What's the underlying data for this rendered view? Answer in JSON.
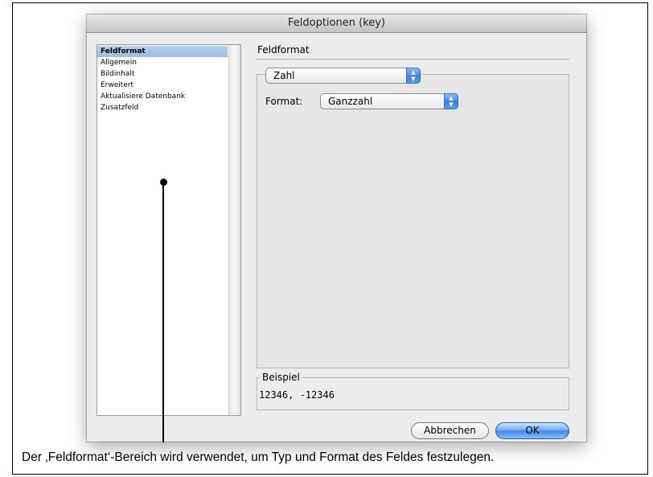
{
  "window": {
    "title": "Feldoptionen (key)"
  },
  "sidebar": {
    "items": [
      {
        "label": "Feldformat",
        "selected": true
      },
      {
        "label": "Allgemein",
        "selected": false
      },
      {
        "label": "Bildinhalt",
        "selected": false
      },
      {
        "label": "Erweitert",
        "selected": false
      },
      {
        "label": "Aktualisiere Datenbank",
        "selected": false
      },
      {
        "label": "Zusatzfeld",
        "selected": false
      }
    ]
  },
  "main": {
    "section_title": "Feldformat",
    "type_popup": {
      "value": "Zahl"
    },
    "format_label": "Format:",
    "format_popup": {
      "value": "Ganzzahl"
    },
    "example": {
      "legend": "Beispiel",
      "value": "12346, -12346"
    }
  },
  "buttons": {
    "cancel_label": "Abbrechen",
    "ok_label": "OK"
  },
  "caption": "Der ‚Feldformat‘-Bereich wird verwendet, um Typ und Format des Feldes festzulegen.",
  "colors": {
    "selection": "#b8d0ec",
    "accent": "#3f86e6",
    "dialog_bg": "#ececec"
  }
}
